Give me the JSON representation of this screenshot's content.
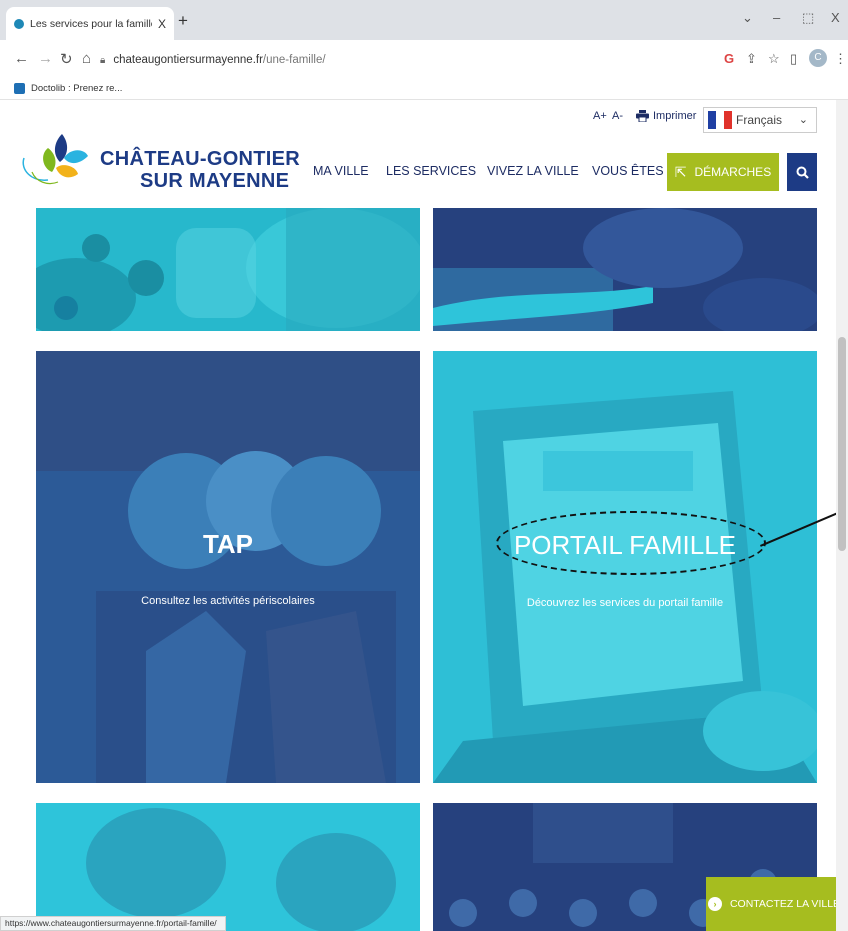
{
  "browser": {
    "tab_title": "Les services pour la famille - Ma",
    "tab_close": "X",
    "new_tab": "+",
    "win_min": "–",
    "win_max": "⬚",
    "win_close": "X",
    "win_chevron": "⌄",
    "url_host": "chateaugontiersurmayenne.fr",
    "url_path": "/une-famille/",
    "bookmark_label": "Doctolib : Prenez re..."
  },
  "site": {
    "accessibility_plus": "A+",
    "accessibility_minus": "A-",
    "print_label": "Imprimer",
    "language_selected": "Français",
    "logo_line1": "CHÂTEAU-GONTIER",
    "logo_line2": "SUR MAYENNE",
    "nav": [
      "MA VILLE",
      "LES SERVICES",
      "VIVEZ LA VILLE",
      "VOUS ÊTES"
    ],
    "demarches_label": "DÉMARCHES",
    "contact_label": "CONTACTEZ LA VILLE",
    "status_url": "https://www.chateaugontiersurmayenne.fr/portail-famille/"
  },
  "tiles": {
    "tap": {
      "title": "TAP",
      "subtitle": "Consultez les activités périscolaires"
    },
    "portail": {
      "title": "PORTAIL FAMILLE",
      "subtitle": "Découvrez les services du portail famille"
    }
  },
  "icons": {
    "back": "back-arrow-icon",
    "forward": "forward-arrow-icon",
    "reload": "reload-icon",
    "home": "home-icon",
    "lock": "lock-icon",
    "google": "google-icon",
    "share": "share-icon",
    "star": "star-icon",
    "sidepanel": "side-panel-icon",
    "print": "printer-icon",
    "search": "search-icon",
    "cursor": "cursor-icon"
  },
  "colors": {
    "brand_blue": "#1d3b85",
    "accent_green": "#a6bd1f",
    "tile_cyan": "#2ec4da",
    "tile_navy": "#26417e"
  }
}
